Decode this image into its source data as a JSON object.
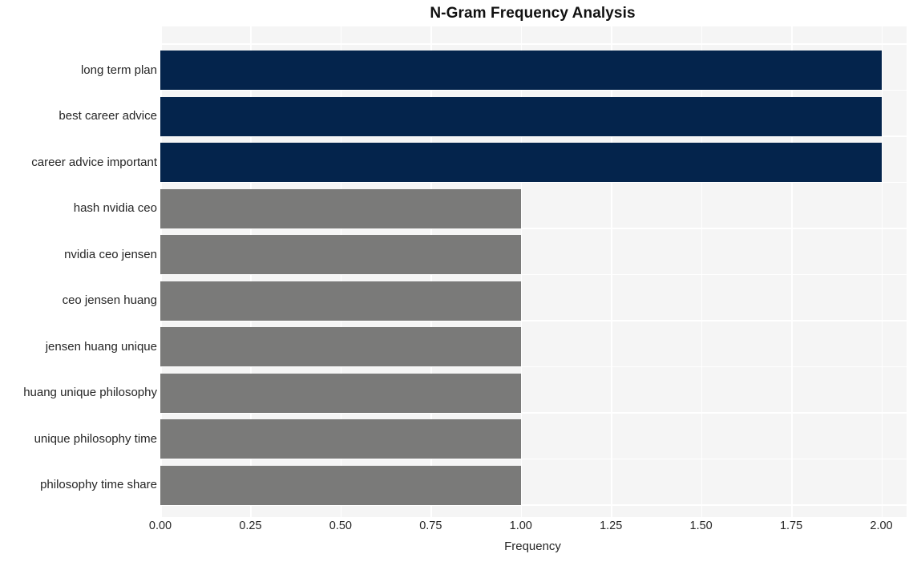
{
  "chart_data": {
    "type": "bar",
    "orientation": "horizontal",
    "title": "N-Gram Frequency Analysis",
    "xlabel": "Frequency",
    "ylabel": "",
    "xlim": [
      0,
      2.07
    ],
    "xticks": [
      "0.00",
      "0.25",
      "0.50",
      "0.75",
      "1.00",
      "1.25",
      "1.50",
      "1.75",
      "2.00"
    ],
    "xtick_values": [
      0,
      0.25,
      0.5,
      0.75,
      1.0,
      1.25,
      1.5,
      1.75,
      2.0
    ],
    "categories": [
      "long term plan",
      "best career advice",
      "career advice important",
      "hash nvidia ceo",
      "nvidia ceo jensen",
      "ceo jensen huang",
      "jensen huang unique",
      "huang unique philosophy",
      "unique philosophy time",
      "philosophy time share"
    ],
    "values": [
      2,
      2,
      2,
      1,
      1,
      1,
      1,
      1,
      1,
      1
    ],
    "bar_colors": [
      "#04244c",
      "#04244c",
      "#04244c",
      "#7a7a79",
      "#7a7a79",
      "#7a7a79",
      "#7a7a79",
      "#7a7a79",
      "#7a7a79",
      "#7a7a79"
    ],
    "grid": true,
    "grid_color": "#ffffff",
    "plot_background": "#f5f5f5",
    "legend": null
  },
  "colors": {
    "accent_navy": "#04244c",
    "accent_gray": "#7a7a79",
    "plot_bg": "#f5f5f5",
    "figure_bg": "#ffffff",
    "text": "#262626",
    "title": "#111111"
  }
}
